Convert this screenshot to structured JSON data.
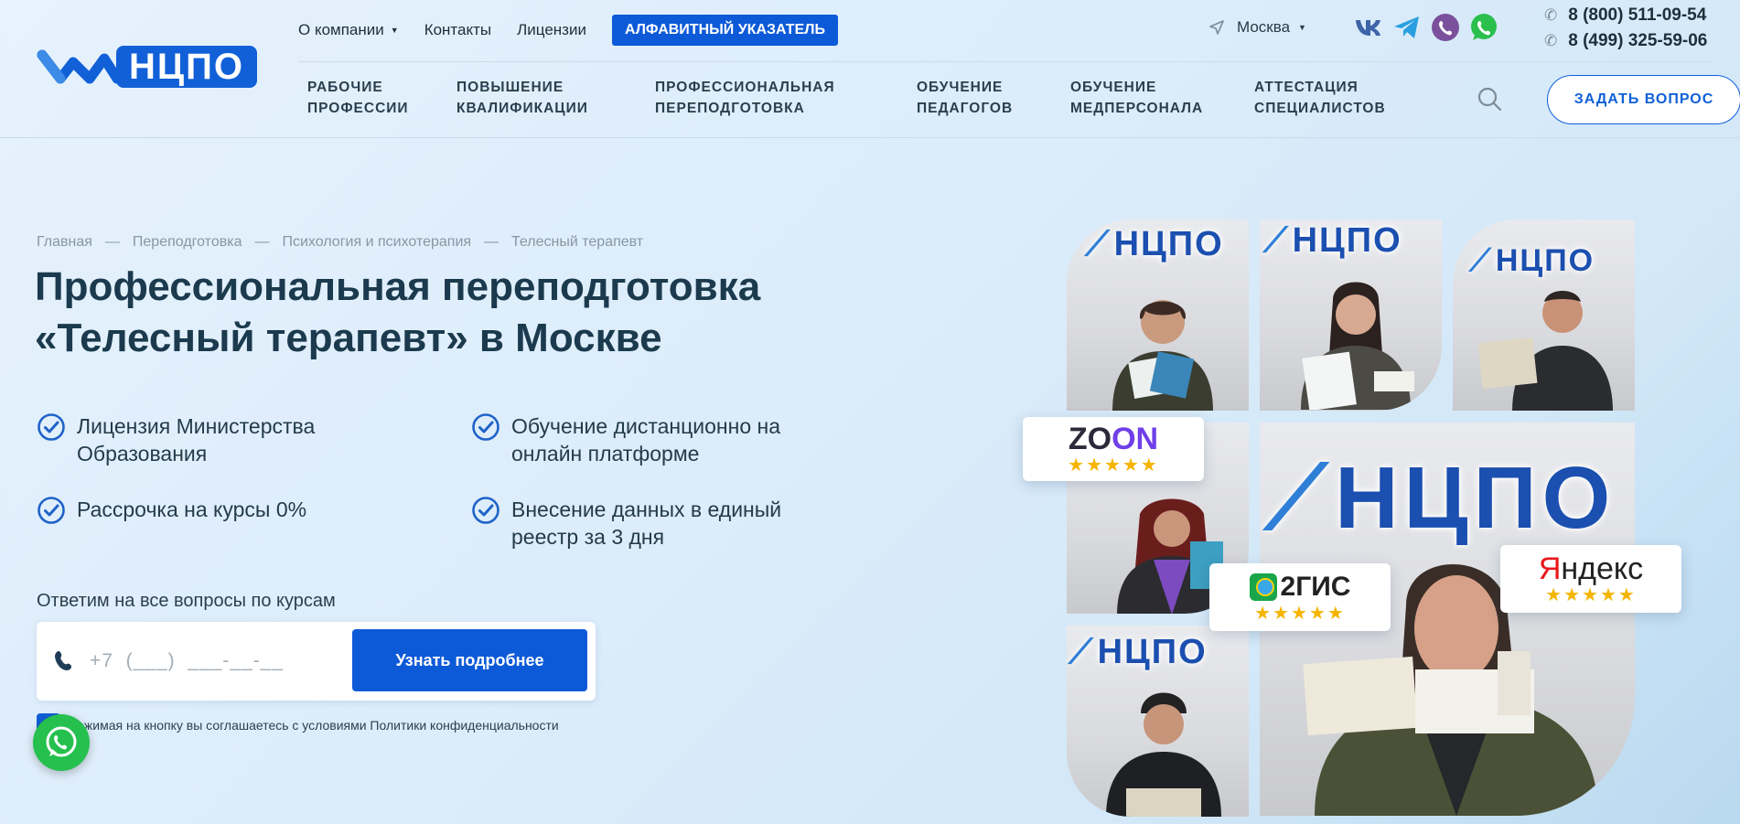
{
  "brand": {
    "logo_text": "НЦПО",
    "colors": {
      "primary": "#1160d8",
      "button": "#0d5ad8",
      "heading": "#1b3a4d",
      "whatsapp": "#25c04e"
    }
  },
  "topnav": {
    "items": [
      {
        "label": "О компании",
        "has_dropdown": true
      },
      {
        "label": "Контакты"
      },
      {
        "label": "Лицензии"
      }
    ],
    "alpha_button": "АЛФАВИТНЫЙ УКАЗАТЕЛЬ"
  },
  "city": {
    "label": "Москва"
  },
  "socials": [
    "vk-icon",
    "telegram-icon",
    "viber-icon",
    "whatsapp-icon"
  ],
  "phones": [
    "8 (800) 511-09-54",
    "8 (499) 325-59-06"
  ],
  "mainnav": [
    {
      "line1": "РАБОЧИЕ",
      "line2": "ПРОФЕССИИ"
    },
    {
      "line1": "ПОВЫШЕНИЕ",
      "line2": "КВАЛИФИКАЦИИ"
    },
    {
      "line1": "ПРОФЕССИОНАЛЬНАЯ",
      "line2": "ПЕРЕПОДГОТОВКА"
    },
    {
      "line1": "ОБУЧЕНИЕ",
      "line2": "ПЕДАГОГОВ"
    },
    {
      "line1": "ОБУЧЕНИЕ",
      "line2": "МЕДПЕРСОНАЛА"
    },
    {
      "line1": "АТТЕСТАЦИЯ",
      "line2": "СПЕЦИАЛИСТОВ"
    }
  ],
  "ask_button": "ЗАДАТЬ ВОПРОС",
  "breadcrumb": [
    "Главная",
    "Переподготовка",
    "Психология и психотерапия",
    "Телесный терапевт"
  ],
  "breadcrumb_sep": "—",
  "title": "Профессиональная переподготовка «Телесный терапевт» в Москве",
  "features": [
    "Лицензия Министерства Образования",
    "Обучение дистанционно на онлайн платформе",
    "Рассрочка на курсы 0%",
    "Внесение данных в единый реестр за 3 дня"
  ],
  "form": {
    "hint": "Ответим на все вопросы по курсам",
    "phone_placeholder": "+7  (___)  ___-__-__",
    "submit": "Узнать подробнее",
    "consent": "Нажимая на кнопку вы соглашаетесь с условиями Политики конфиденциальности"
  },
  "ratings": {
    "zoon": {
      "name_a": "ZO",
      "name_b": "ON",
      "stars": "★★★★★"
    },
    "gis": {
      "name": "2ГИС",
      "stars": "★★★★★"
    },
    "yandex": {
      "name_a": "Я",
      "name_b": "ндекс",
      "stars": "★★★★★"
    }
  },
  "photo_logo": "НЦПО"
}
